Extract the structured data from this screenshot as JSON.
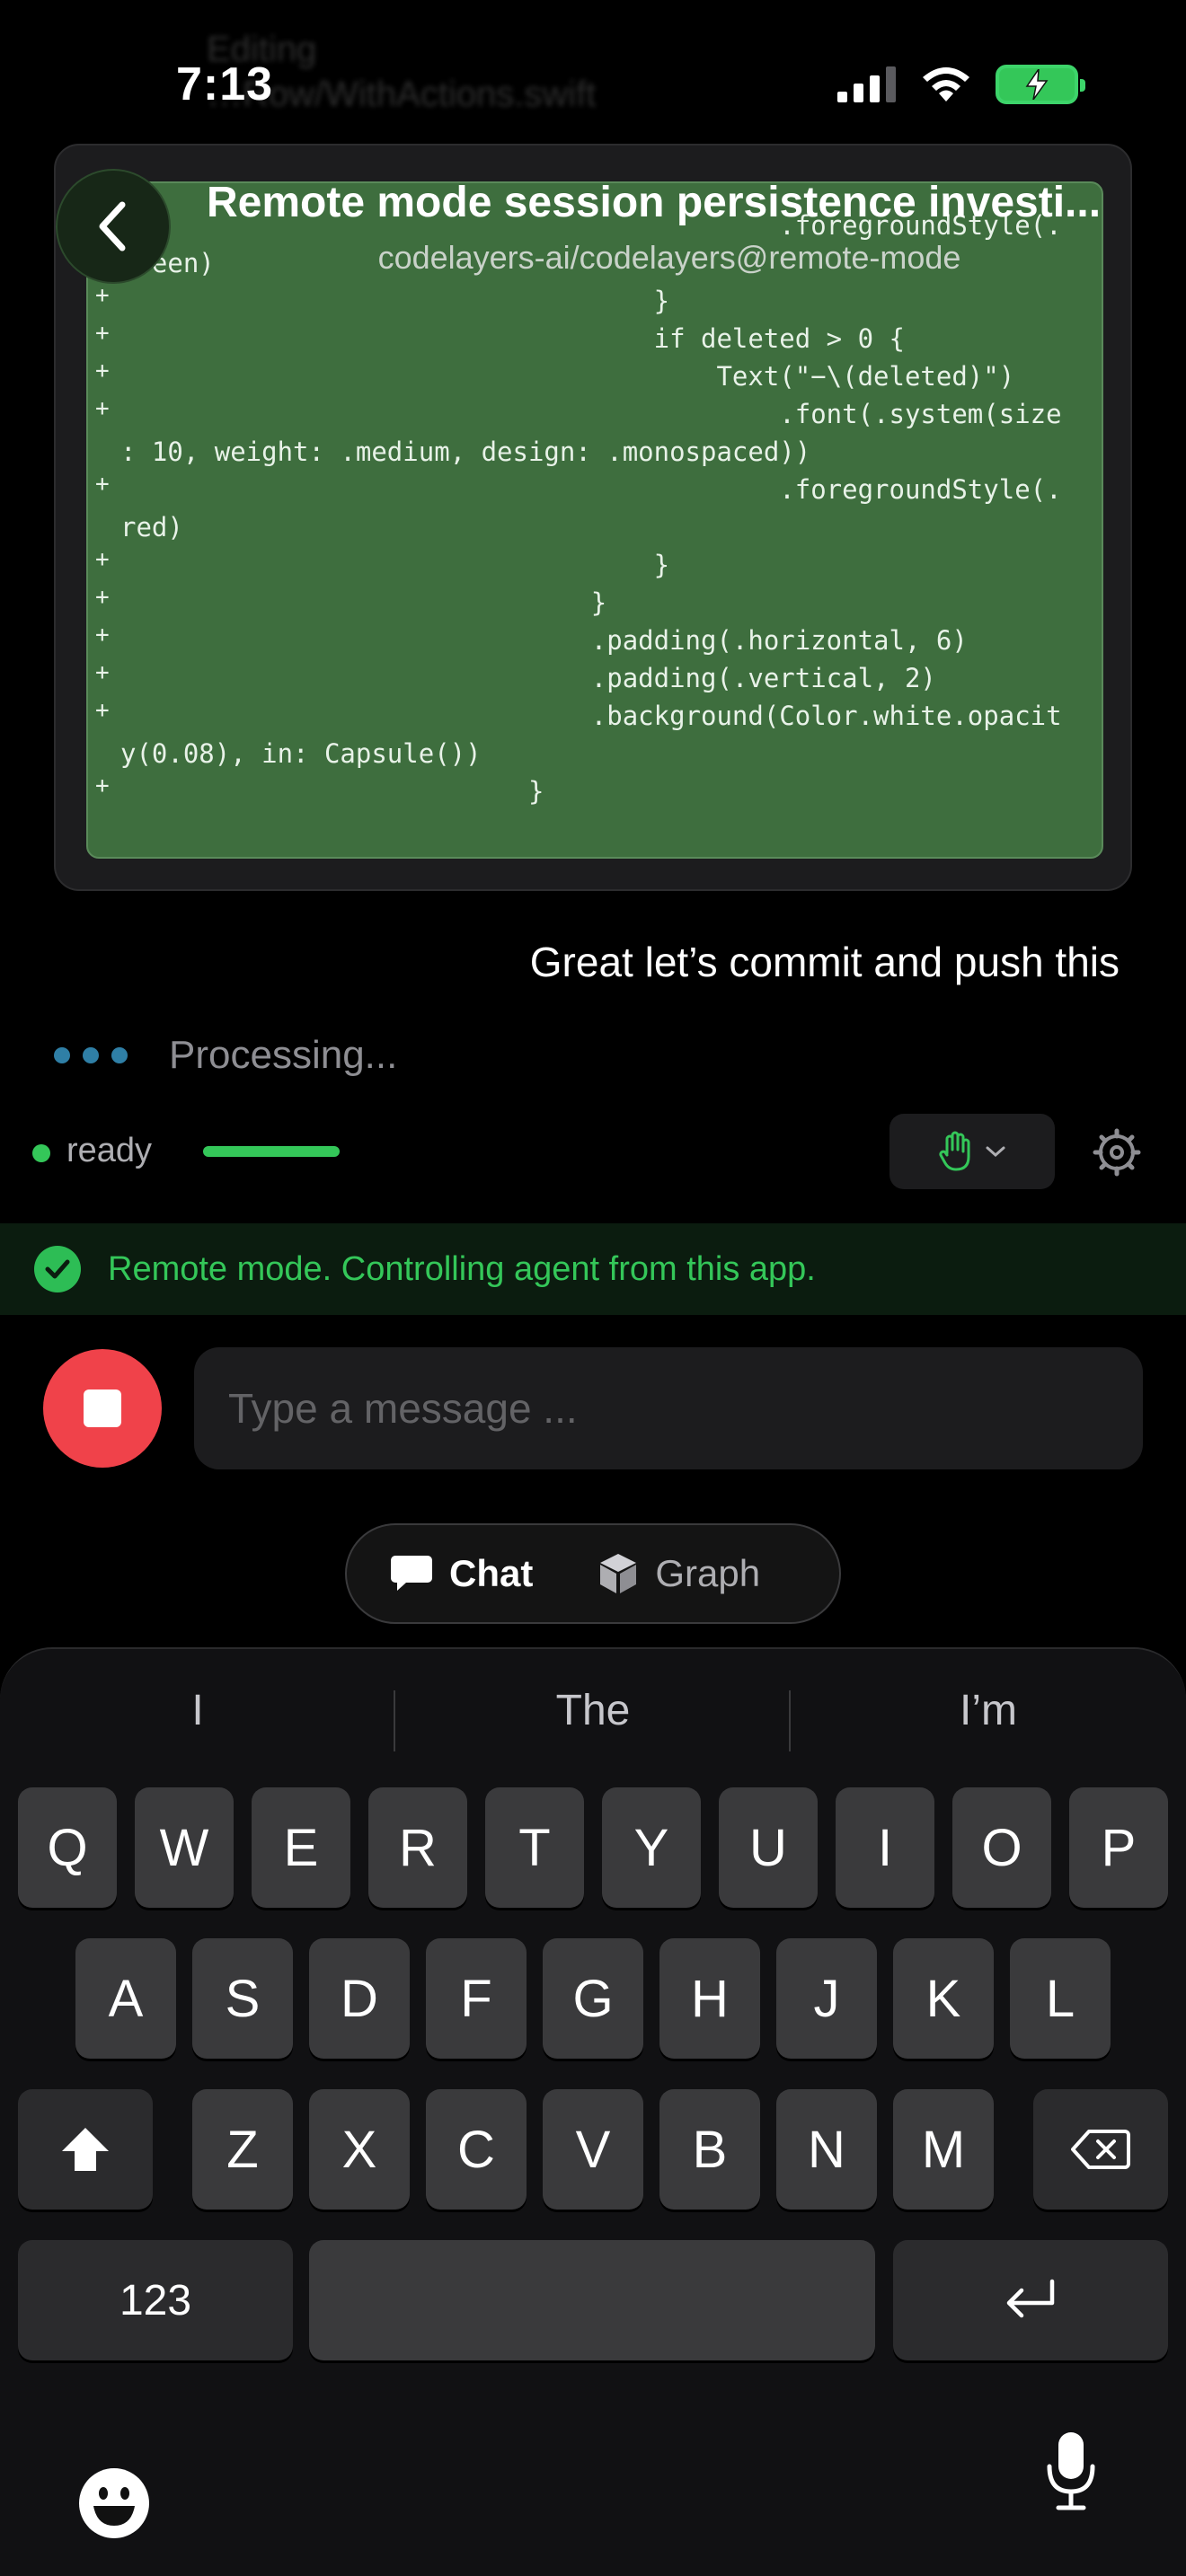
{
  "status_bar": {
    "time": "7:13"
  },
  "ghost_header": {
    "line1": "Editing",
    "line2": "…Row/WithActions.swift"
  },
  "header": {
    "title": "Remote mode session persistence investi...",
    "subtitle": "codelayers-ai/codelayers@remote-mode"
  },
  "code_card": {
    "lines": [
      {
        "plus": "+",
        "text": "                                          .foregroundStyle(."
      },
      {
        "plus": "",
        "text": "green)"
      },
      {
        "plus": "+",
        "text": "                                  }"
      },
      {
        "plus": "+",
        "text": "                                  if deleted > 0 {"
      },
      {
        "plus": "+",
        "text": "                                      Text(\"−\\(deleted)\")"
      },
      {
        "plus": "+",
        "text": "                                          .font(.system(size"
      },
      {
        "plus": "",
        "text": ": 10, weight: .medium, design: .monospaced))"
      },
      {
        "plus": "+",
        "text": "                                          .foregroundStyle(."
      },
      {
        "plus": "",
        "text": "red)"
      },
      {
        "plus": "+",
        "text": "                                  }"
      },
      {
        "plus": "+",
        "text": "                              }"
      },
      {
        "plus": "+",
        "text": "                              .padding(.horizontal, 6)"
      },
      {
        "plus": "+",
        "text": "                              .padding(.vertical, 2)"
      },
      {
        "plus": "+",
        "text": "                              .background(Color.white.opacit"
      },
      {
        "plus": "",
        "text": "y(0.08), in: Capsule())"
      },
      {
        "plus": "+",
        "text": "                          }"
      }
    ]
  },
  "user_message": "Great let’s commit and push this",
  "processing": {
    "text": "Processing..."
  },
  "status_row": {
    "ready_label": "ready",
    "mode_icon": "hand-raised-icon",
    "settings_icon": "gear-icon"
  },
  "banner": {
    "text": "Remote mode. Controlling agent from this app."
  },
  "composer": {
    "placeholder": "Type a message ..."
  },
  "view_toggle": {
    "chat_label": "Chat",
    "graph_label": "Graph"
  },
  "keyboard": {
    "suggestions": [
      "I",
      "The",
      "I’m"
    ],
    "row1": [
      "Q",
      "W",
      "E",
      "R",
      "T",
      "Y",
      "U",
      "I",
      "O",
      "P"
    ],
    "row2": [
      "A",
      "S",
      "D",
      "F",
      "G",
      "H",
      "J",
      "K",
      "L"
    ],
    "row3": [
      "Z",
      "X",
      "C",
      "V",
      "B",
      "N",
      "M"
    ],
    "numbers_label": "123"
  },
  "colors": {
    "accent_green": "#34c759",
    "stop_red": "#f0424a",
    "code_bg": "#3e6e3e"
  }
}
